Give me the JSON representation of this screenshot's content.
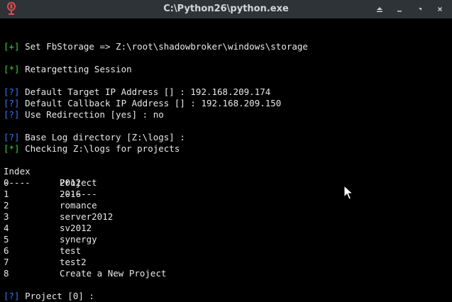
{
  "window": {
    "title": "C:\\Python26\\python.exe"
  },
  "terminal": {
    "tag_plus": "[+]",
    "tag_star": "[*]",
    "tag_q": "[?]",
    "line_storage": " Set FbStorage => Z:\\root\\shadowbroker\\windows\\storage",
    "line_retarget": " Retargetting Session",
    "line_target_ip": " Default Target IP Address [] : 192.168.209.174",
    "line_callback_ip": " Default Callback IP Address [] : 192.168.209.150",
    "line_redirection": " Use Redirection [yes] : no",
    "line_log_dir": " Base Log directory [Z:\\logs] :",
    "line_checking": " Checking Z:\\logs for projects",
    "table": {
      "header_index": "Index",
      "header_project": "Project",
      "sep_index": "-----",
      "sep_project": "-------",
      "rows": [
        {
          "index": "0",
          "project": "2012"
        },
        {
          "index": "1",
          "project": "2016"
        },
        {
          "index": "2",
          "project": "romance"
        },
        {
          "index": "3",
          "project": "server2012"
        },
        {
          "index": "4",
          "project": "sv2012"
        },
        {
          "index": "5",
          "project": "synergy"
        },
        {
          "index": "6",
          "project": "test"
        },
        {
          "index": "7",
          "project": "test2"
        },
        {
          "index": "8",
          "project": "Create a New Project"
        }
      ]
    },
    "line_prompt": " Project [0] :"
  },
  "colors": {
    "tag_plus": "#2fd53f",
    "tag_q": "#2f78ff",
    "text": "#e8e8e8",
    "background": "#000000",
    "titlebar": "#2e3338"
  },
  "icons": {
    "app": "python-app-icon",
    "shade": "shade-up-icon",
    "minimize": "minimize-icon",
    "maximize": "maximize-icon",
    "close": "close-icon"
  }
}
